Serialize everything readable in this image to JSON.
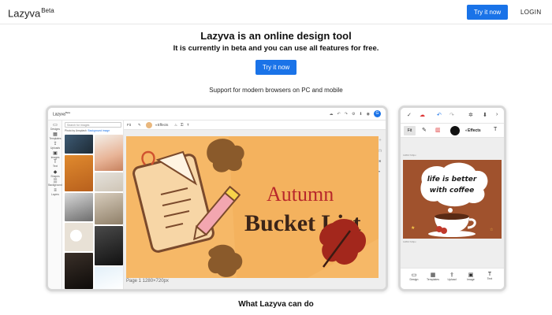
{
  "nav": {
    "brand": "Lazyva",
    "brand_tag": "Beta",
    "try_label": "Try it now",
    "login_label": "LOGIN"
  },
  "hero": {
    "title": "Lazyva is an online design tool",
    "subtitle": "It is currently in beta and you can use all features for free.",
    "cta_label": "Try it now"
  },
  "support_text": "Support for modern browsers on PC and mobile",
  "desktop": {
    "brand": "Lazyva",
    "brand_tag": "Beta",
    "avatar": "G",
    "sidebar": [
      "Designs",
      "Templates",
      "Uploads",
      "Images",
      "Text",
      "Shapes",
      "Background",
      "Layers"
    ],
    "search_placeholder": "Search for images",
    "photo_credit": "Photo by Unsplash",
    "bg_tab": "Background image",
    "toolbar": {
      "fit": "Fit",
      "effects": "Effects"
    },
    "canvas": {
      "line1": "Autumn",
      "line2": "Bucket List"
    },
    "page_info": "Page 1 1280×720px"
  },
  "mobile": {
    "fit": "Fit",
    "effects": "Effects",
    "canvas": {
      "line1": "life is better",
      "line2": "with coffee"
    },
    "page_caption": "1280×720px",
    "bottom": [
      "Design",
      "Templates",
      "Upload",
      "Image",
      "Text"
    ]
  },
  "section_heading": "What Lazyva can do",
  "colors": {
    "accent": "#1a73e8",
    "autumn_bg": "#f6b867",
    "coffee_bg": "#a0522d"
  }
}
